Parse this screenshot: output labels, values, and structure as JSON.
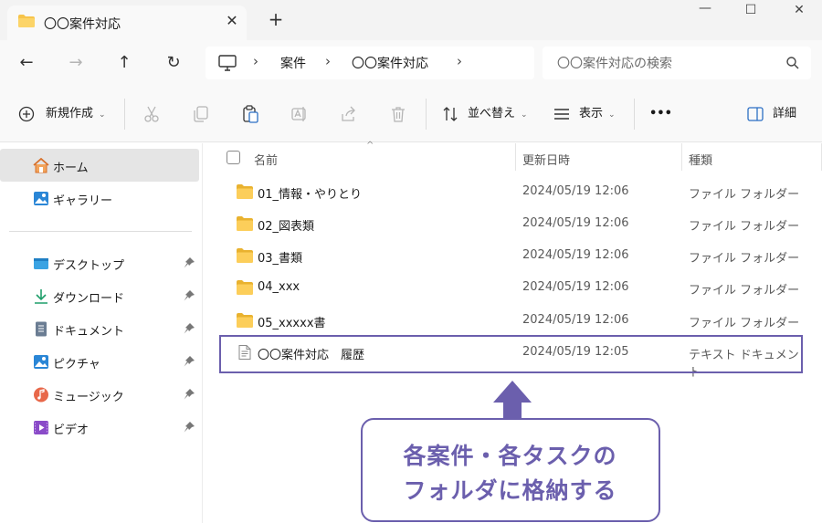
{
  "window": {
    "tab_title": "〇〇案件対応",
    "tab_close": "✕",
    "new_tab": "+",
    "controls": {
      "minimize": "—",
      "maximize": "☐",
      "close": "✕"
    }
  },
  "nav": {
    "back": "←",
    "forward": "→",
    "up": "↑",
    "refresh": "↻",
    "separator": "›",
    "breadcrumb": [
      "案件",
      "〇〇案件対応"
    ],
    "search_placeholder": "〇〇案件対応の検索"
  },
  "commands": {
    "new_label": "新規作成",
    "sort_label": "並べ替え",
    "view_label": "表示",
    "more_label": "•••",
    "details_label": "詳細"
  },
  "sidebar": {
    "top_items": [
      {
        "label": "ホーム",
        "icon": "home-icon",
        "selected": true
      },
      {
        "label": "ギャラリー",
        "icon": "gallery-icon",
        "selected": false
      }
    ],
    "pinned_items": [
      {
        "label": "デスクトップ",
        "icon": "desktop-icon"
      },
      {
        "label": "ダウンロード",
        "icon": "download-icon"
      },
      {
        "label": "ドキュメント",
        "icon": "documents-icon"
      },
      {
        "label": "ピクチャ",
        "icon": "pictures-icon"
      },
      {
        "label": "ミュージック",
        "icon": "music-icon"
      },
      {
        "label": "ビデオ",
        "icon": "videos-icon"
      }
    ]
  },
  "list": {
    "columns": {
      "name": "名前",
      "date": "更新日時",
      "type": "種類"
    },
    "sort_caret": "^",
    "rows": [
      {
        "name": "01_情報・やりとり",
        "date": "2024/05/19 12:06",
        "type": "ファイル フォルダー",
        "icon": "folder-icon"
      },
      {
        "name": "02_図表類",
        "date": "2024/05/19 12:06",
        "type": "ファイル フォルダー",
        "icon": "folder-icon"
      },
      {
        "name": "03_書類",
        "date": "2024/05/19 12:06",
        "type": "ファイル フォルダー",
        "icon": "folder-icon"
      },
      {
        "name": "04_xxx",
        "date": "2024/05/19 12:06",
        "type": "ファイル フォルダー",
        "icon": "folder-icon"
      },
      {
        "name": "05_xxxxx書",
        "date": "2024/05/19 12:06",
        "type": "ファイル フォルダー",
        "icon": "folder-icon"
      },
      {
        "name": "〇〇案件対応　履歴",
        "date": "2024/05/19 12:05",
        "type": "テキスト ドキュメント",
        "icon": "text-file-icon"
      }
    ]
  },
  "annotation": {
    "line1": "各案件・各タスクの",
    "line2": "フォルダに格納する",
    "color": "#6b5fad"
  }
}
